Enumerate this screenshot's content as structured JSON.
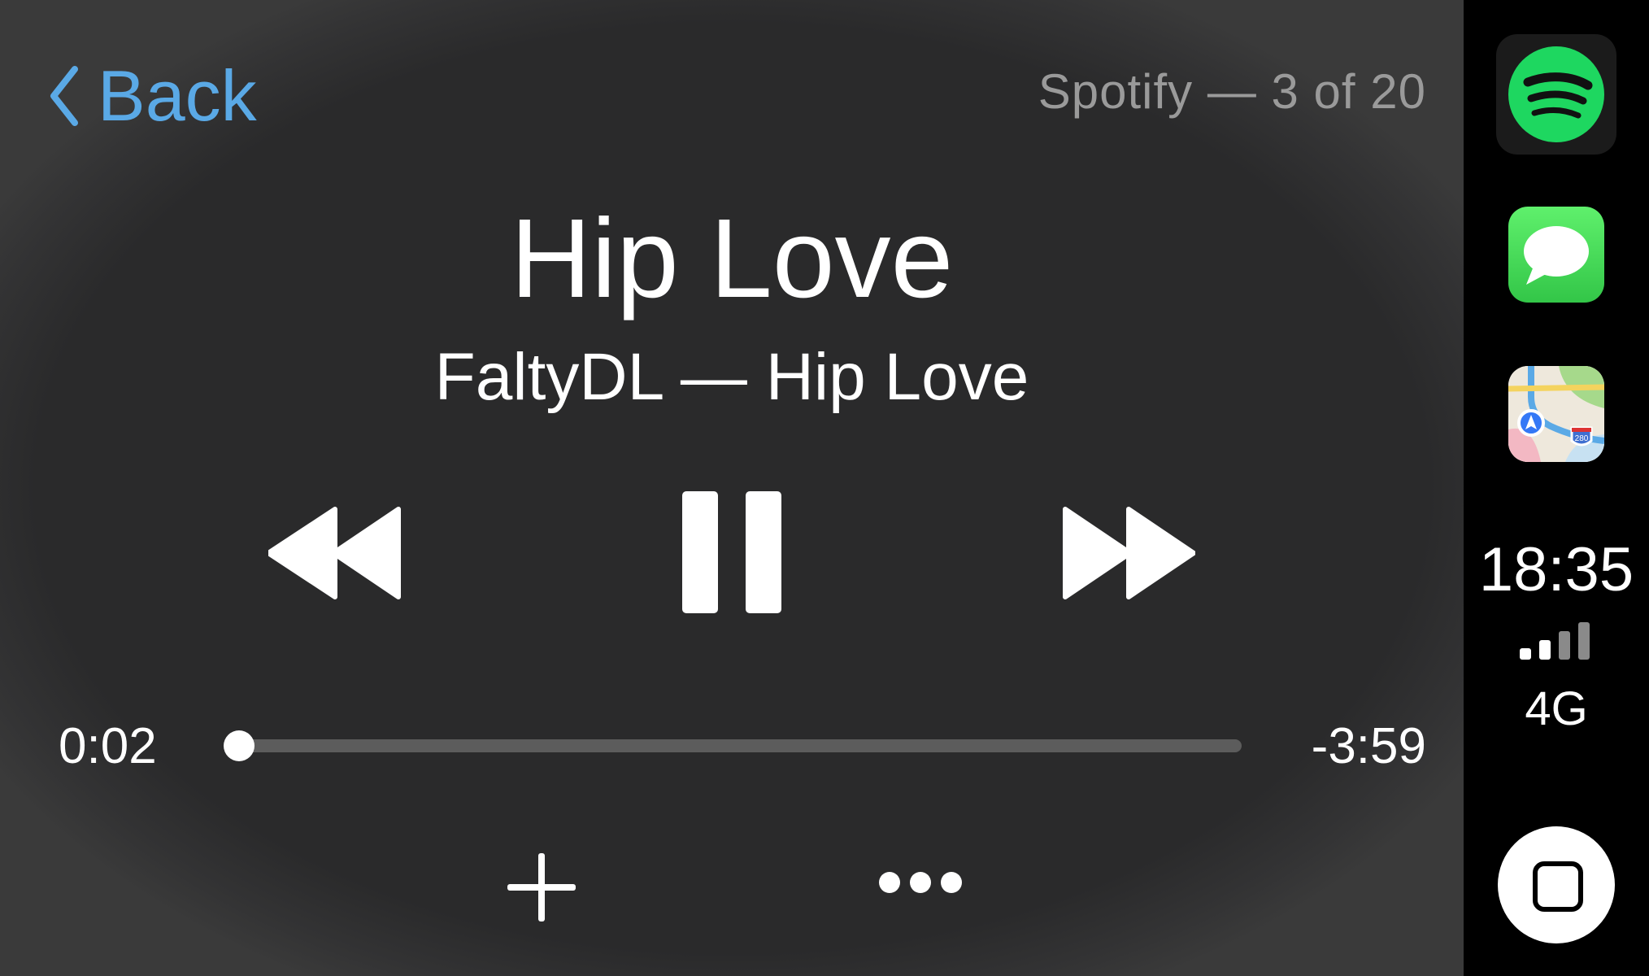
{
  "header": {
    "back_label": "Back",
    "source_label": "Spotify — 3 of 20"
  },
  "track": {
    "title": "Hip Love",
    "subtitle": "FaltyDL — Hip Love"
  },
  "progress": {
    "elapsed": "0:02",
    "remaining": "-3:59",
    "fraction": 0.008
  },
  "controls": {
    "rewind_icon": "rewind-icon",
    "pause_icon": "pause-icon",
    "forward_icon": "fast-forward-icon",
    "add_icon": "plus-icon",
    "more_icon": "ellipsis-icon"
  },
  "dock": {
    "apps": [
      {
        "name": "spotify",
        "icon": "spotify-icon",
        "color": "#1ed760"
      },
      {
        "name": "messages",
        "icon": "messages-icon",
        "color": "#34c759"
      },
      {
        "name": "maps",
        "icon": "maps-icon",
        "map_shield": "280"
      }
    ],
    "time": "18:35",
    "signal_bars_active": 2,
    "signal_bars_total": 4,
    "network": "4G"
  },
  "colors": {
    "accent": "#5aa9e6",
    "background": "#2a2a2b",
    "dock_background": "#000000"
  }
}
